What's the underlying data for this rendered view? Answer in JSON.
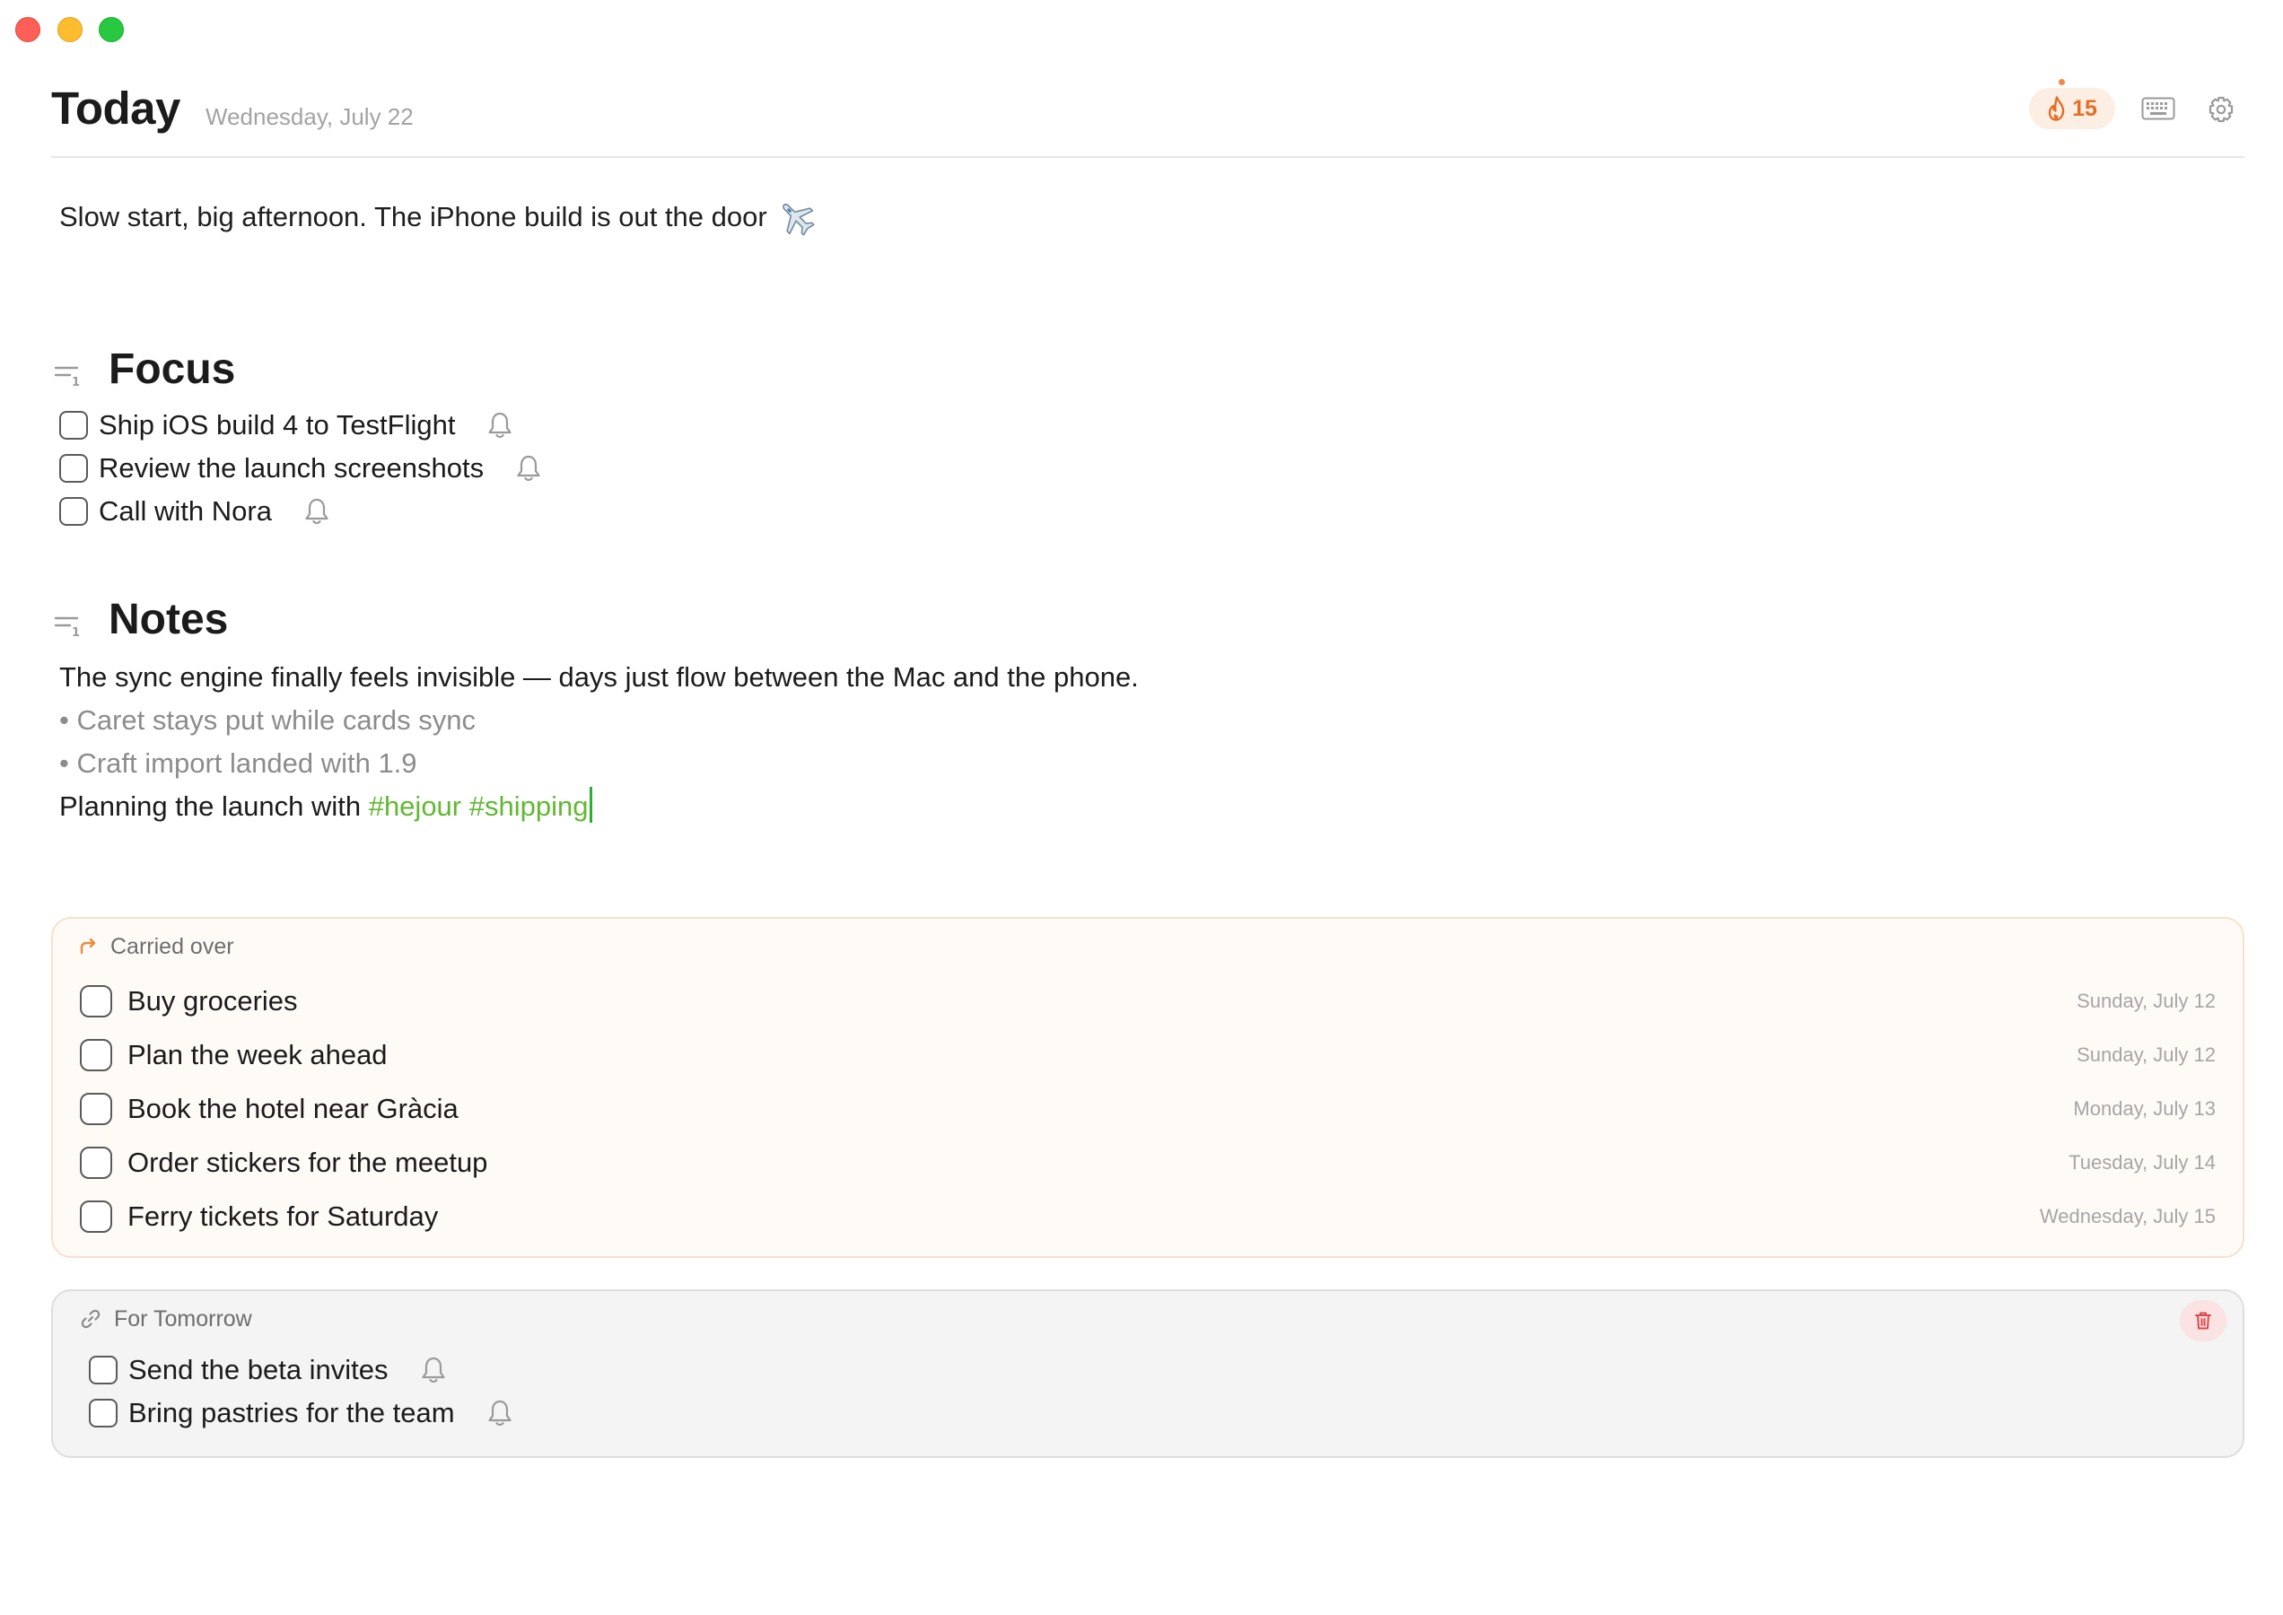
{
  "window": {
    "controls": [
      "close",
      "minimize",
      "zoom"
    ]
  },
  "header": {
    "title": "Today",
    "date": "Wednesday, July 22",
    "streak_count": "15",
    "streak_icon": "flame-icon",
    "keyboard_icon": "keyboard-icon",
    "settings_icon": "gear-icon",
    "accent_color": "#e56e24"
  },
  "intro": {
    "text": "Slow start, big afternoon. The iPhone build is out the door",
    "emoji": "airplane"
  },
  "focus": {
    "title": "Focus",
    "tasks": [
      {
        "label": "Ship iOS build 4 to TestFlight",
        "done": false,
        "reminder": true
      },
      {
        "label": "Review the launch screenshots",
        "done": false,
        "reminder": true
      },
      {
        "label": "Call with Nora",
        "done": false,
        "reminder": true
      }
    ]
  },
  "notes": {
    "title": "Notes",
    "line1": "The sync engine finally feels invisible — days just flow between the Mac and the phone.",
    "bullets": [
      "• Caret stays put while cards sync",
      "• Craft import landed with 1.9"
    ],
    "line4_prefix": "Planning the launch with",
    "tags": [
      "#hejour",
      "#shipping"
    ],
    "tag_color": "#61b832"
  },
  "carried_over": {
    "title": "Carried over",
    "items": [
      {
        "label": "Buy groceries",
        "date": "Sunday, July 12"
      },
      {
        "label": "Plan the week ahead",
        "date": "Sunday, July 12"
      },
      {
        "label": "Book the hotel near Gràcia",
        "date": "Monday, July 13"
      },
      {
        "label": "Order stickers for the meetup",
        "date": "Tuesday, July 14"
      },
      {
        "label": "Ferry tickets for Saturday",
        "date": "Wednesday, July 15"
      }
    ]
  },
  "for_tomorrow": {
    "title": "For Tomorrow",
    "tasks": [
      {
        "label": "Send the beta invites",
        "reminder": true
      },
      {
        "label": "Bring pastries for the team",
        "reminder": true
      }
    ]
  }
}
